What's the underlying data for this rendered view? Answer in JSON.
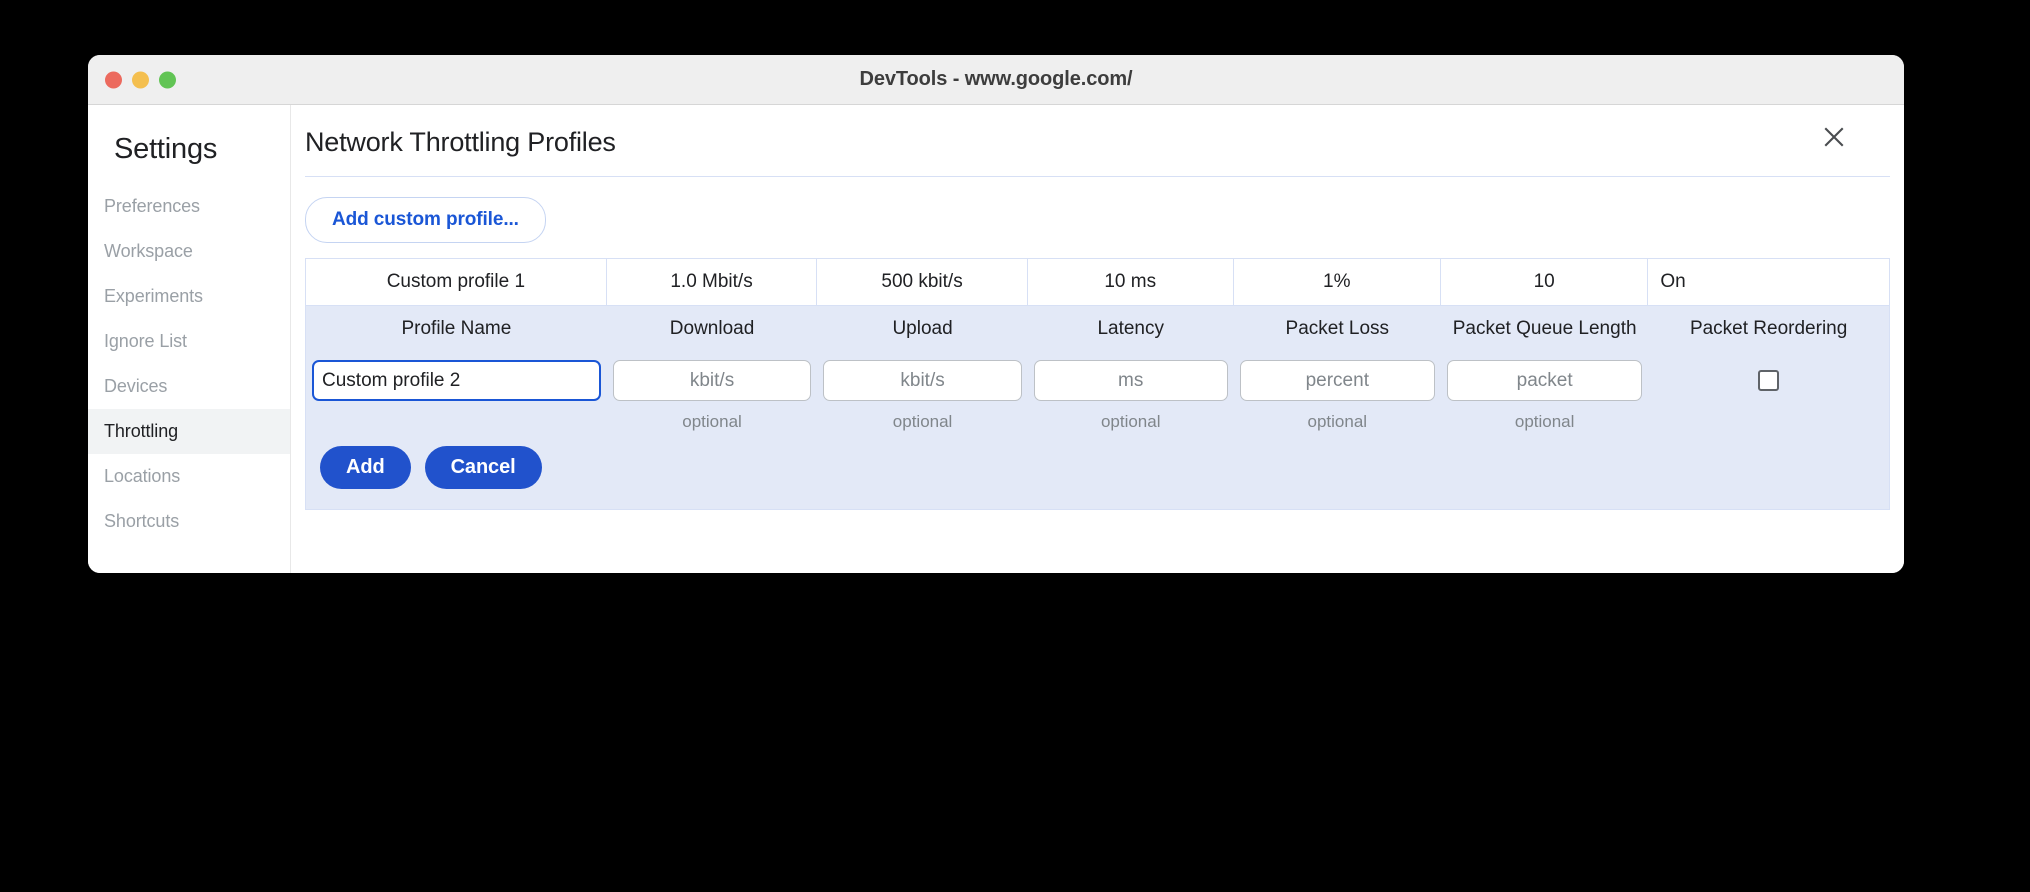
{
  "window": {
    "title": "DevTools - www.google.com/",
    "traffic_lights": [
      "close-red",
      "minimize-yellow",
      "maximize-green"
    ]
  },
  "sidebar": {
    "title": "Settings",
    "items": [
      {
        "label": "Preferences",
        "selected": false
      },
      {
        "label": "Workspace",
        "selected": false
      },
      {
        "label": "Experiments",
        "selected": false
      },
      {
        "label": "Ignore List",
        "selected": false
      },
      {
        "label": "Devices",
        "selected": false
      },
      {
        "label": "Throttling",
        "selected": true
      },
      {
        "label": "Locations",
        "selected": false
      },
      {
        "label": "Shortcuts",
        "selected": false
      }
    ]
  },
  "main": {
    "panel_title": "Network Throttling Profiles",
    "close_icon": "close-icon",
    "add_profile_button": "Add custom profile...",
    "table": {
      "columns": [
        "Profile Name",
        "Download",
        "Upload",
        "Latency",
        "Packet Loss",
        "Packet Queue Length",
        "Packet Reordering"
      ],
      "existing_row": [
        "Custom profile 1",
        "1.0 Mbit/s",
        "500 kbit/s",
        "10 ms",
        "1%",
        "10",
        "On"
      ],
      "edit_row": {
        "profile_name_value": "Custom profile 2",
        "fields": [
          {
            "name": "download",
            "placeholder": "kbit/s",
            "hint": "optional"
          },
          {
            "name": "upload",
            "placeholder": "kbit/s",
            "hint": "optional"
          },
          {
            "name": "latency",
            "placeholder": "ms",
            "hint": "optional"
          },
          {
            "name": "packet-loss",
            "placeholder": "percent",
            "hint": "optional"
          },
          {
            "name": "packet-queue-length",
            "placeholder": "packet",
            "hint": "optional"
          }
        ],
        "packet_reordering_checked": false
      },
      "actions": {
        "add_label": "Add",
        "cancel_label": "Cancel"
      }
    }
  },
  "colors": {
    "accent_blue": "#2152cc",
    "link_blue": "#1a56d6",
    "table_header_bg": "#e3e9f7",
    "table_border": "#d7e0f5",
    "sidebar_selected_bg": "#f1f3f4",
    "muted_text": "#9aa0a6",
    "titlebar_bg": "#efefef"
  }
}
